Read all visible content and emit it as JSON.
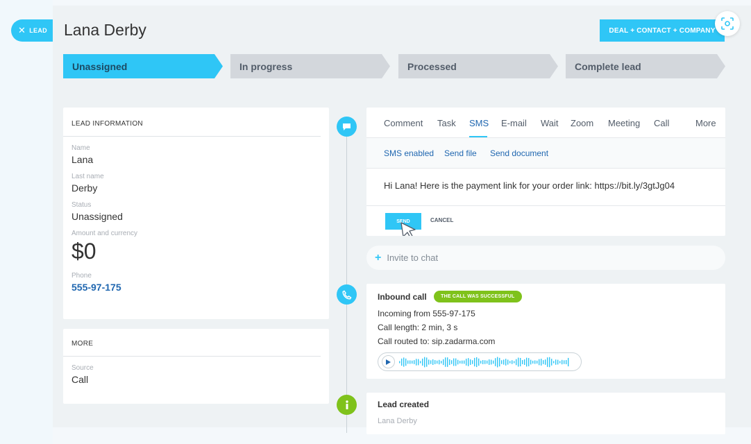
{
  "lead_tab": {
    "label": "LEAD"
  },
  "header": {
    "title": "Lana Derby",
    "convert_button": "DEAL + CONTACT + COMPANY"
  },
  "stages": [
    {
      "label": "Unassigned",
      "active": true
    },
    {
      "label": "In progress",
      "active": false
    },
    {
      "label": "Processed",
      "active": false
    },
    {
      "label": "Complete lead",
      "active": false
    }
  ],
  "lead_info": {
    "title": "LEAD INFORMATION",
    "fields": [
      {
        "label": "Name",
        "value": "Lana"
      },
      {
        "label": "Last name",
        "value": "Derby"
      },
      {
        "label": "Status",
        "value": "Unassigned"
      },
      {
        "label": "Amount and currency",
        "value": "$0"
      },
      {
        "label": "Phone",
        "value": "555-97-175"
      }
    ]
  },
  "more": {
    "title": "MORE",
    "fields": [
      {
        "label": "Source",
        "value": "Call"
      }
    ]
  },
  "composer": {
    "tabs": [
      "Comment",
      "Task",
      "SMS",
      "E-mail",
      "Wait",
      "Zoom",
      "Meeting",
      "Call",
      "More"
    ],
    "active_tab": "SMS",
    "subtabs": [
      "SMS enabled",
      "Send file",
      "Send document"
    ],
    "message": "Hi Lana! Here is the payment link for your order link: https://bit.ly/3gtJg04",
    "send_label": "SEND",
    "cancel_label": "CANCEL"
  },
  "invite": {
    "label": "Invite to chat"
  },
  "call": {
    "title": "Inbound call",
    "badge": "THE CALL WAS SUCCESSFUL",
    "lines": [
      "Incoming from 555-97-175",
      "Call length: 2 min, 3 s",
      "Call routed to: sip.zadarma.com"
    ]
  },
  "created": {
    "title": "Lead created",
    "subtitle": "Lana Derby"
  },
  "colors": {
    "accent": "#2fc6f6",
    "link": "#2067b0",
    "success": "#7fc21b"
  }
}
